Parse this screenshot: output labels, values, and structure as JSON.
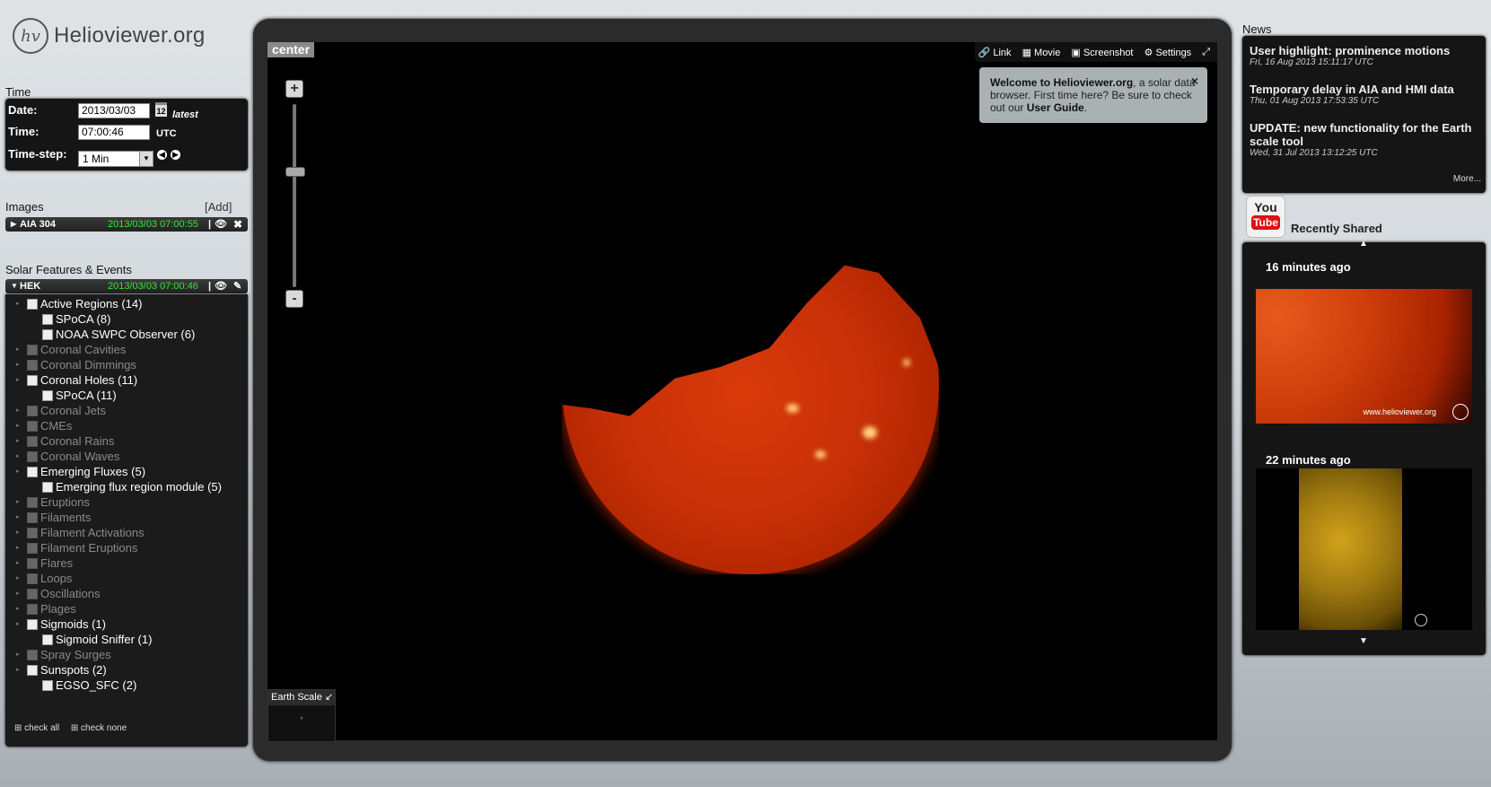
{
  "brand": {
    "logo_mark": "hv",
    "name": "Helioviewer.org"
  },
  "time": {
    "section_title": "Time",
    "date_label": "Date:",
    "date_value": "2013/03/03",
    "calendar_day": "12",
    "latest_label": "latest",
    "time_label": "Time:",
    "time_value": "07:00:46",
    "tz": "UTC",
    "step_label": "Time-step:",
    "step_value": "1 Min"
  },
  "images": {
    "section_title": "Images",
    "add_label": "[Add]",
    "layer_name": "AIA 304",
    "layer_time": "2013/03/03 07:00:55"
  },
  "features": {
    "section_title": "Solar Features & Events",
    "hek_label": "HEK",
    "hek_time": "2013/03/03 07:00:46",
    "items": [
      {
        "label": "Active Regions (14)",
        "level": 0,
        "active": true
      },
      {
        "label": "SPoCA (8)",
        "level": 1,
        "active": true
      },
      {
        "label": "NOAA SWPC Observer (6)",
        "level": 1,
        "active": true
      },
      {
        "label": "Coronal Cavities",
        "level": 0,
        "active": false
      },
      {
        "label": "Coronal Dimmings",
        "level": 0,
        "active": false
      },
      {
        "label": "Coronal Holes (11)",
        "level": 0,
        "active": true
      },
      {
        "label": "SPoCA (11)",
        "level": 1,
        "active": true
      },
      {
        "label": "Coronal Jets",
        "level": 0,
        "active": false
      },
      {
        "label": "CMEs",
        "level": 0,
        "active": false
      },
      {
        "label": "Coronal Rains",
        "level": 0,
        "active": false
      },
      {
        "label": "Coronal Waves",
        "level": 0,
        "active": false
      },
      {
        "label": "Emerging Fluxes (5)",
        "level": 0,
        "active": true
      },
      {
        "label": "Emerging flux region module (5)",
        "level": 1,
        "active": true
      },
      {
        "label": "Eruptions",
        "level": 0,
        "active": false
      },
      {
        "label": "Filaments",
        "level": 0,
        "active": false
      },
      {
        "label": "Filament Activations",
        "level": 0,
        "active": false
      },
      {
        "label": "Filament Eruptions",
        "level": 0,
        "active": false
      },
      {
        "label": "Flares",
        "level": 0,
        "active": false
      },
      {
        "label": "Loops",
        "level": 0,
        "active": false
      },
      {
        "label": "Oscillations",
        "level": 0,
        "active": false
      },
      {
        "label": "Plages",
        "level": 0,
        "active": false
      },
      {
        "label": "Sigmoids (1)",
        "level": 0,
        "active": true
      },
      {
        "label": "Sigmoid Sniffer (1)",
        "level": 1,
        "active": true
      },
      {
        "label": "Spray Surges",
        "level": 0,
        "active": false
      },
      {
        "label": "Sunspots (2)",
        "level": 0,
        "active": true
      },
      {
        "label": "EGSO_SFC (2)",
        "level": 1,
        "active": true
      }
    ],
    "check_all": "check all",
    "check_none": "check none"
  },
  "viewer": {
    "center_label": "center",
    "toolbar": {
      "link": "Link",
      "movie": "Movie",
      "screenshot": "Screenshot",
      "settings": "Settings"
    },
    "welcome": {
      "strong": "Welcome to Helioviewer.org",
      "text1": ", a solar data browser. First time here? Be sure to check out our ",
      "link": "User Guide",
      "text2": "."
    },
    "zoom_in": "+",
    "zoom_out": "-",
    "earth_scale_label": "Earth Scale"
  },
  "news": {
    "section_title": "News",
    "items": [
      {
        "title": "User highlight: prominence motions",
        "date": "Fri, 16 Aug 2013 15:11:17 UTC"
      },
      {
        "title": "Temporary delay in AIA and HMI data",
        "date": "Thu, 01 Aug 2013 17:53:35 UTC"
      },
      {
        "title": "UPDATE: new functionality for the Earth scale tool",
        "date": "Wed, 31 Jul 2013 13:12:25 UTC"
      }
    ],
    "more": "More..."
  },
  "youtube": {
    "you": "You",
    "tube": "Tube",
    "title": "Recently Shared",
    "items": [
      {
        "age": "16 minutes ago",
        "watermark": "www.helioviewer.org"
      },
      {
        "age": "22 minutes ago"
      }
    ]
  }
}
